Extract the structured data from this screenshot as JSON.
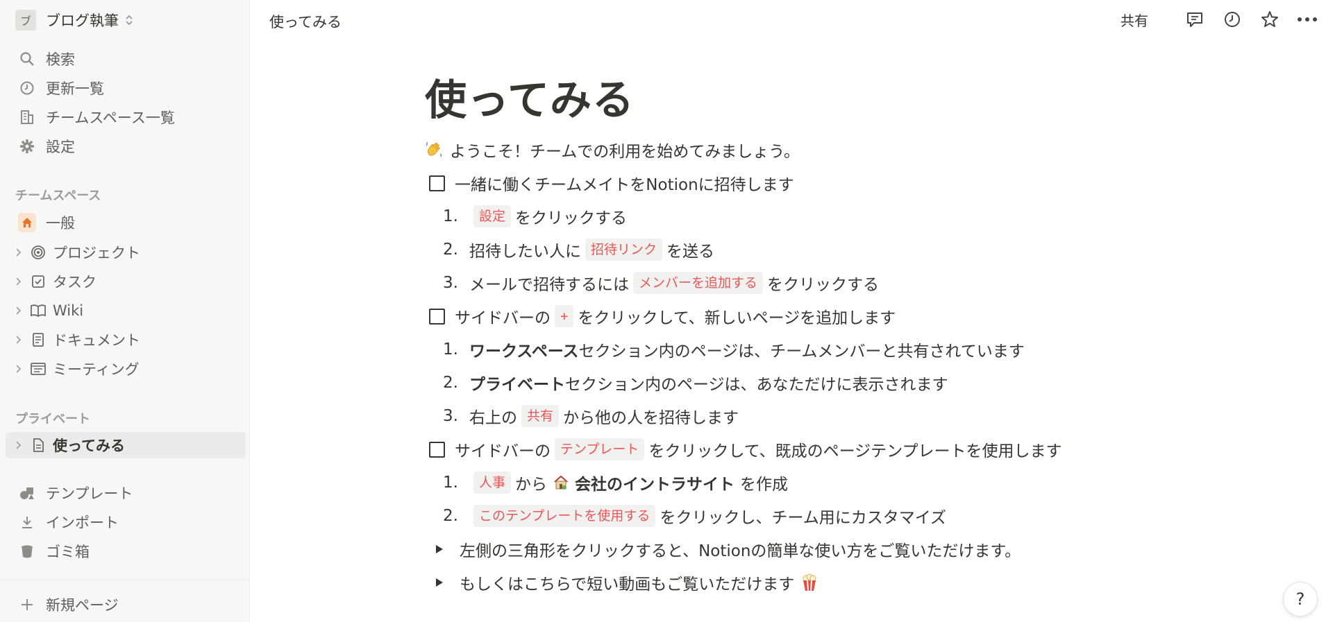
{
  "workspace": {
    "avatar": "ブ",
    "name": "ブログ執筆"
  },
  "sidebar": {
    "top_items": [
      {
        "label": "検索",
        "icon": "search-icon"
      },
      {
        "label": "更新一覧",
        "icon": "clock-icon"
      },
      {
        "label": "チームスペース一覧",
        "icon": "building-icon"
      },
      {
        "label": "設定",
        "icon": "gear-icon"
      }
    ],
    "teamspace_label": "チームスペース",
    "teamspace_items": [
      {
        "label": "一般",
        "icon": "home-icon"
      },
      {
        "label": "プロジェクト",
        "icon": "target-icon"
      },
      {
        "label": "タスク",
        "icon": "checkbox-icon"
      },
      {
        "label": "Wiki",
        "icon": "book-icon"
      },
      {
        "label": "ドキュメント",
        "icon": "document-icon"
      },
      {
        "label": "ミーティング",
        "icon": "calendar-icon"
      }
    ],
    "private_label": "プライベート",
    "private_items": [
      {
        "label": "使ってみる",
        "icon": "page-icon"
      }
    ],
    "bottom_items": [
      {
        "label": "テンプレート",
        "icon": "shapes-icon"
      },
      {
        "label": "インポート",
        "icon": "download-icon"
      },
      {
        "label": "ゴミ箱",
        "icon": "trash-icon"
      }
    ],
    "new_page_label": "新規ページ"
  },
  "topbar": {
    "breadcrumb": "使ってみる",
    "share_label": "共有"
  },
  "page": {
    "title": "使ってみる",
    "welcome": "ようこそ！チームでの利用を始めてみましょう。",
    "todo1": "一緒に働くチームメイトをNotionに招待します",
    "todo1_steps": {
      "s1_num": "1.",
      "s1_tag": "設定",
      "s1_text": "をクリックする",
      "s2_num": "2.",
      "s2_pre": "招待したい人に",
      "s2_tag": "招待リンク",
      "s2_text": "を送る",
      "s3_num": "3.",
      "s3_pre": "メールで招待するには",
      "s3_tag": "メンバーを追加する",
      "s3_text": "をクリックする"
    },
    "todo2": {
      "pre": "サイドバーの",
      "tag": "+",
      "text": "をクリックして、新しいページを追加します"
    },
    "todo2_steps": {
      "s1_num": "1.",
      "s1_bold": "ワークスペース",
      "s1_text": "セクション内のページは、チームメンバーと共有されています",
      "s2_num": "2.",
      "s2_bold": "プライベート",
      "s2_text": "セクション内のページは、あなただけに表示されます",
      "s3_num": "3.",
      "s3_pre": "右上の",
      "s3_tag": "共有",
      "s3_text": "から他の人を招待します"
    },
    "todo3": {
      "pre": "サイドバーの",
      "tag": "テンプレート",
      "text": "をクリックして、既成のページテンプレートを使用します"
    },
    "todo3_steps": {
      "s1_num": "1.",
      "s1_tag": "人事",
      "s1_pre": "から",
      "s1_bold": "会社のイントラサイト",
      "s1_text": "を作成",
      "s2_num": "2.",
      "s2_tag": "このテンプレートを使用する",
      "s2_text": "をクリックし、チーム用にカスタマイズ"
    },
    "toggle1": "左側の三角形をクリックすると、Notionの簡単な使い方をご覧いただけます。",
    "toggle2": "もしくはこちらで短い動画もご覧いただけます"
  },
  "help_label": "?"
}
